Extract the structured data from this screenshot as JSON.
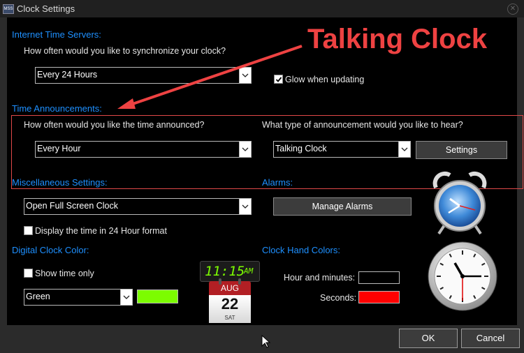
{
  "window": {
    "title": "Clock Settings",
    "app_icon_text": "MSS"
  },
  "internet_time": {
    "heading": "Internet Time Servers:",
    "question": "How often would you like to synchronize your clock?",
    "sync_value": "Every 24 Hours",
    "glow_label": "Glow when updating",
    "glow_checked": true
  },
  "announcements": {
    "heading": "Time Announcements:",
    "question": "How often would you like the time announced?",
    "frequency_value": "Every Hour",
    "type_question": "What type of announcement would you like to hear?",
    "type_value": "Talking Clock",
    "settings_button": "Settings"
  },
  "misc": {
    "heading": "Miscellaneous Settings:",
    "action_value": "Open Full Screen Clock",
    "format24_label": "Display the time in 24 Hour format",
    "format24_checked": false
  },
  "alarms": {
    "heading": "Alarms:",
    "manage_button": "Manage Alarms"
  },
  "digital_color": {
    "heading": "Digital Clock Color:",
    "show_time_only_label": "Show time only",
    "show_time_only_checked": false,
    "color_value": "Green",
    "swatch_color": "#7cfc00"
  },
  "preview": {
    "digital_time": "11:15",
    "digital_ampm": "AM",
    "calendar_month": "AUG",
    "calendar_day": "22",
    "calendar_weekday": "SAT"
  },
  "hand_colors": {
    "heading": "Clock Hand Colors:",
    "hour_label": "Hour and minutes:",
    "hour_color": "#000000",
    "seconds_label": "Seconds:",
    "seconds_color": "#ff0000"
  },
  "annotation": {
    "text": "Talking Clock",
    "color": "#ee4242"
  },
  "footer": {
    "ok_label": "OK",
    "cancel_label": "Cancel"
  }
}
